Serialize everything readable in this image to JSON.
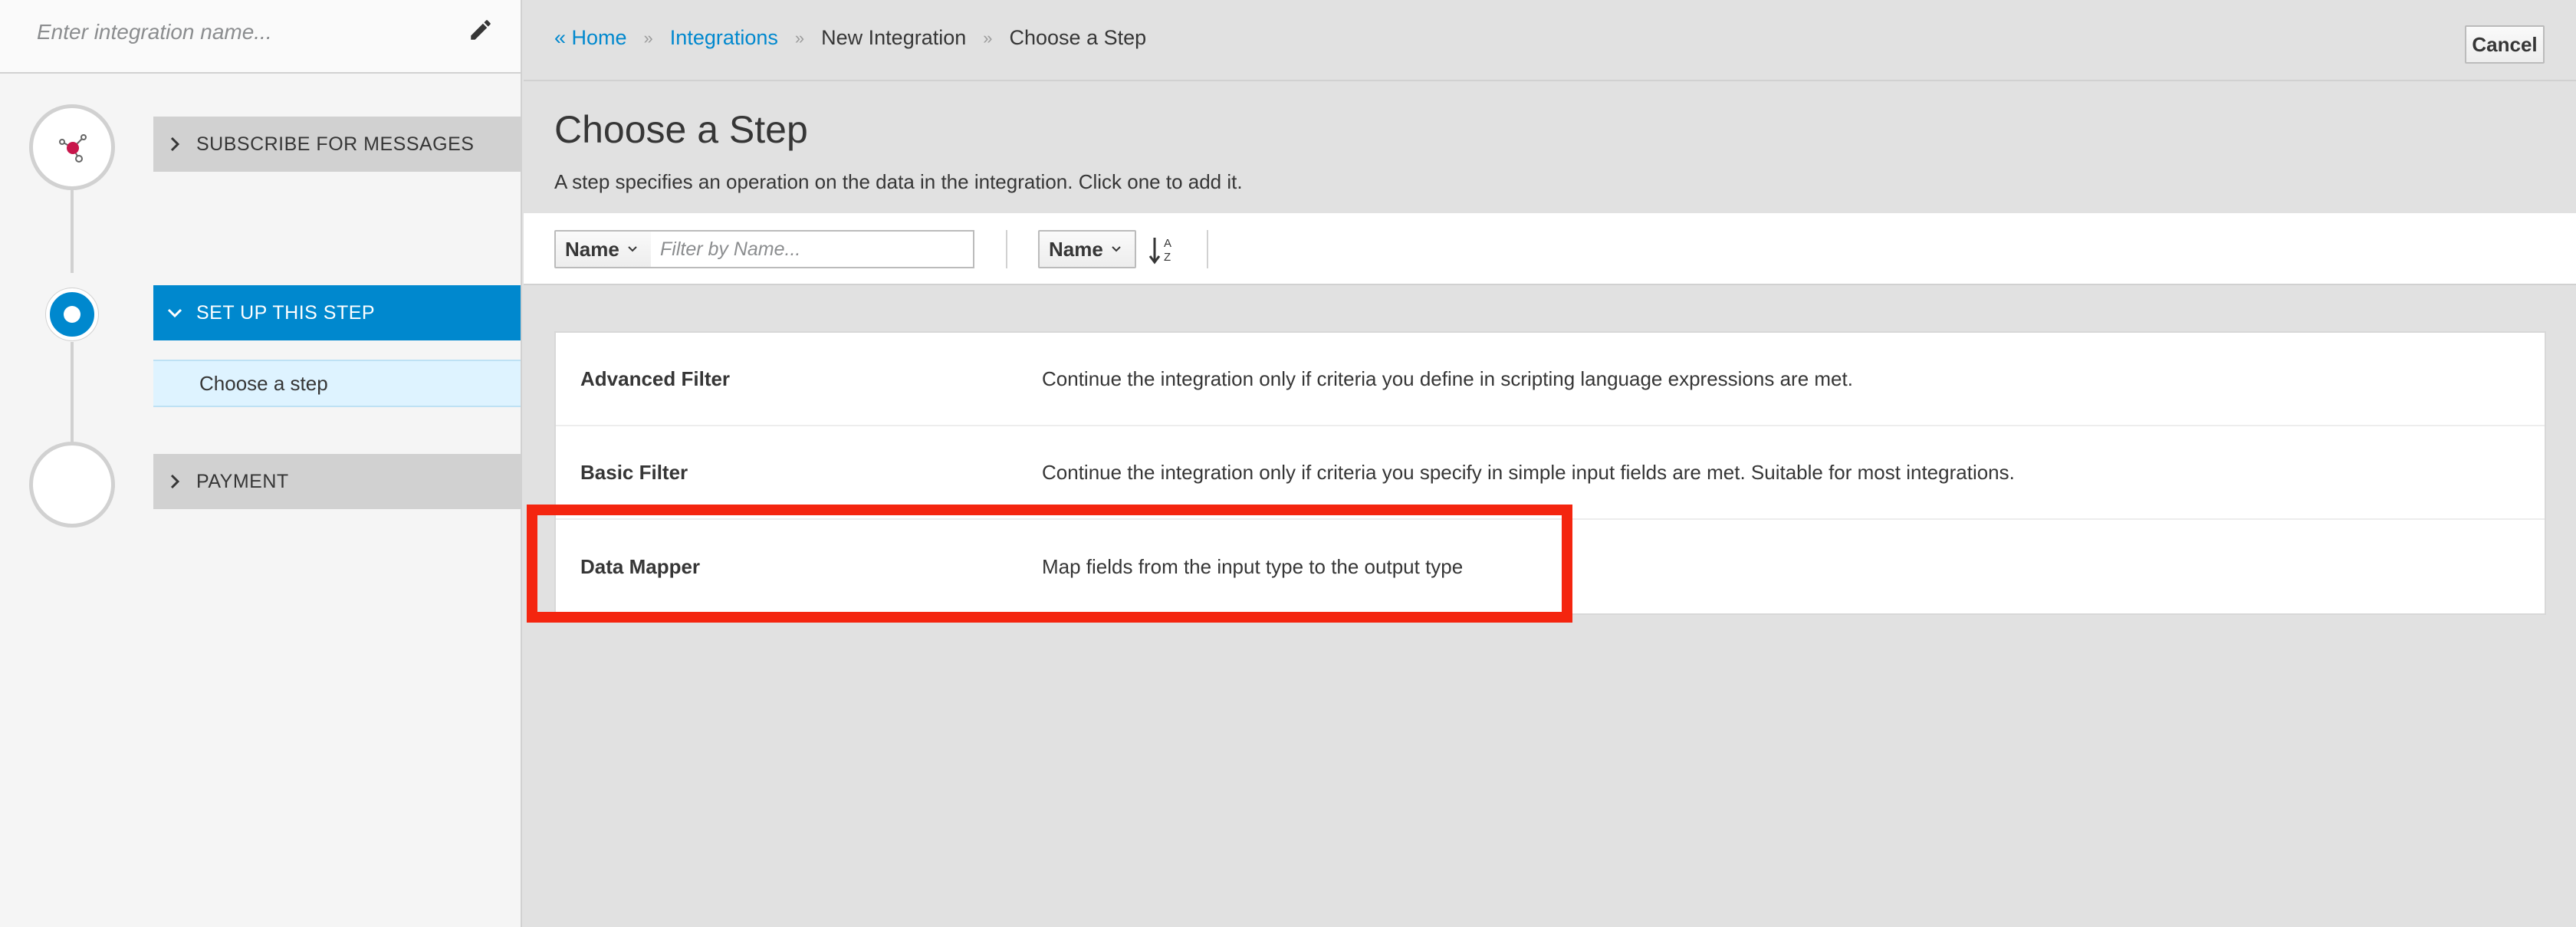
{
  "sidebar": {
    "name_placeholder": "Enter integration name...",
    "steps": [
      {
        "label": "SUBSCRIBE FOR MESSAGES",
        "state": "collapsed"
      },
      {
        "label": "SET UP THIS STEP",
        "state": "active",
        "sub_item": "Choose a step"
      },
      {
        "label": "PAYMENT",
        "state": "collapsed"
      }
    ]
  },
  "breadcrumb": {
    "home": "« Home",
    "integrations": "Integrations",
    "new_integration": "New Integration",
    "current": "Choose a Step",
    "separator": "»"
  },
  "header": {
    "cancel_label": "Cancel",
    "title": "Choose a Step",
    "description": "A step specifies an operation on the data in the integration. Click one to add it."
  },
  "toolbar": {
    "filter_field": "Name",
    "filter_placeholder": "Filter by Name...",
    "sort_field": "Name"
  },
  "steps_list": [
    {
      "name": "Advanced Filter",
      "description": "Continue the integration only if criteria you define in scripting language expressions are met."
    },
    {
      "name": "Basic Filter",
      "description": "Continue the integration only if criteria you specify in simple input fields are met. Suitable for most integrations."
    },
    {
      "name": "Data Mapper",
      "description": "Map fields from the input type to the output type"
    }
  ],
  "colors": {
    "accent": "#0088ce",
    "highlight": "#f4250f",
    "active_sub_bg": "#def3ff"
  }
}
